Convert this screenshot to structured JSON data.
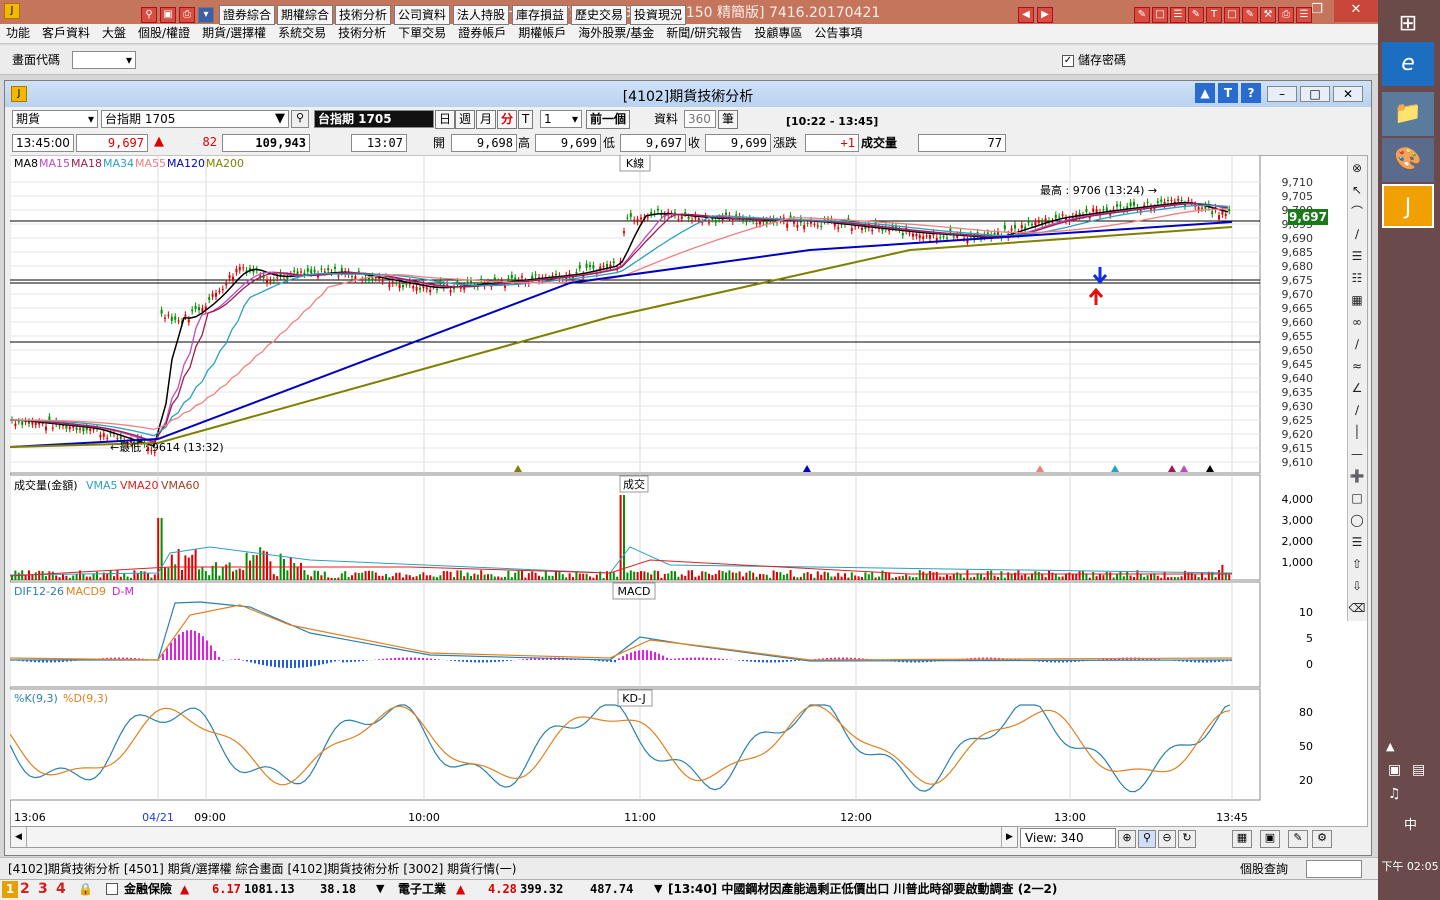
{
  "app": {
    "title": "JIHSUN HTS     [IP : 139, 223, 150 精簡版] 7416.20170421"
  },
  "menu": [
    "功能",
    "客戶資料",
    "大盤",
    "個股/權證",
    "期貨/選擇權",
    "系統交易",
    "技術分析",
    "下單交易",
    "證券帳戶",
    "期權帳戶",
    "海外股票/基金",
    "新聞/研究報告",
    "投顧專區",
    "公告事項"
  ],
  "toolbar": {
    "code_label": "畫面代碼",
    "buttons": [
      "證券綜合",
      "期權綜合",
      "技術分析",
      "公司資料",
      "法人持股",
      "庫存損益",
      "歷史交易",
      "投資現況"
    ],
    "save_pw": "儲存密碼"
  },
  "window": {
    "title": "[4102]期貨技術分析"
  },
  "controls": {
    "type_select": "期貨",
    "contract": "台指期 1705",
    "contract_label": "台指期 1705",
    "day": "日",
    "week": "週",
    "month": "月",
    "minute": "分",
    "t": "T",
    "interval": "1",
    "prev": "前一個",
    "data_label": "資料",
    "data_count": "360",
    "unit": "筆",
    "range": "[10:22 - 13:45]"
  },
  "quote": {
    "time": "13:45:00",
    "price": "9,697",
    "change": "82",
    "volume": "109,943",
    "bar_time": "13:07",
    "open_label": "開",
    "open": "9,698",
    "high_label": "高",
    "high": "9,699",
    "low_label": "低",
    "low": "9,697",
    "close_label": "收",
    "close": "9,699",
    "chg_label": "漲跌",
    "chg": "+1",
    "vol_label": "成交量",
    "vol": "77"
  },
  "colors": {
    "ma8": "#000000",
    "ma15": "#c04ac0",
    "ma18": "#a01c50",
    "ma34": "#2aa0c0",
    "ma55": "#f08080",
    "ma120": "#0000c0",
    "ma200": "#808000",
    "up": "#e00000",
    "down": "#009000"
  },
  "panels": {
    "kline": {
      "title": "K線",
      "legend": [
        "MA8",
        "MA15",
        "MA18",
        "MA34",
        "MA55",
        "MA120",
        "MA200"
      ],
      "high_note": "最高 : 9706 (13:24) →",
      "low_note": "←最低 : 9614 (13:32)",
      "last": "9,697",
      "yticks": [
        "9,710",
        "9,705",
        "9,700",
        "9,695",
        "9,690",
        "9,685",
        "9,680",
        "9,675",
        "9,670",
        "9,665",
        "9,660",
        "9,655",
        "9,650",
        "9,645",
        "9,640",
        "9,635",
        "9,630",
        "9,625",
        "9,620",
        "9,615",
        "9,610"
      ]
    },
    "volume": {
      "title": "成交",
      "legend": [
        "成交量(金額)",
        "VMA5",
        "VMA20",
        "VMA60"
      ],
      "yticks": [
        "4,000",
        "3,000",
        "2,000",
        "1,000"
      ]
    },
    "macd": {
      "title": "MACD",
      "legend": [
        "DIF12-26",
        "MACD9",
        "D-M"
      ],
      "yticks": [
        "10",
        "5",
        "0"
      ]
    },
    "kd": {
      "title": "KD-J",
      "legend": [
        "%K(9,3)",
        "%D(9,3)"
      ],
      "yticks": [
        "80",
        "50",
        "20"
      ]
    }
  },
  "xaxis": [
    "13:06",
    "04/21",
    "09:00",
    "10:00",
    "11:00",
    "12:00",
    "13:00",
    "13:45"
  ],
  "view": "View: 340",
  "tabs": [
    "[4102]期貨技術分析",
    "[4501] 期貨/選擇權 綜合畫面",
    "[4102]期貨技術分析",
    "[3002] 期貨行情(一)"
  ],
  "stock_query": "個股查詢",
  "status": {
    "pages": [
      "1",
      "2",
      "3",
      "4"
    ],
    "item1": "金融保險",
    "v1a": "6.17",
    "v1b": "1081.13",
    "v1c": "38.18",
    "item2": "電子工業",
    "v2a": "4.28",
    "v2b": "399.32",
    "v2c": "487.74",
    "news": "[13:40] 中國鋼材因產能過剩正低價出口 川普此時卻要啟動調查 (2一2)"
  },
  "taskbar": {
    "time": "下午 02:05",
    "ime": "中"
  }
}
